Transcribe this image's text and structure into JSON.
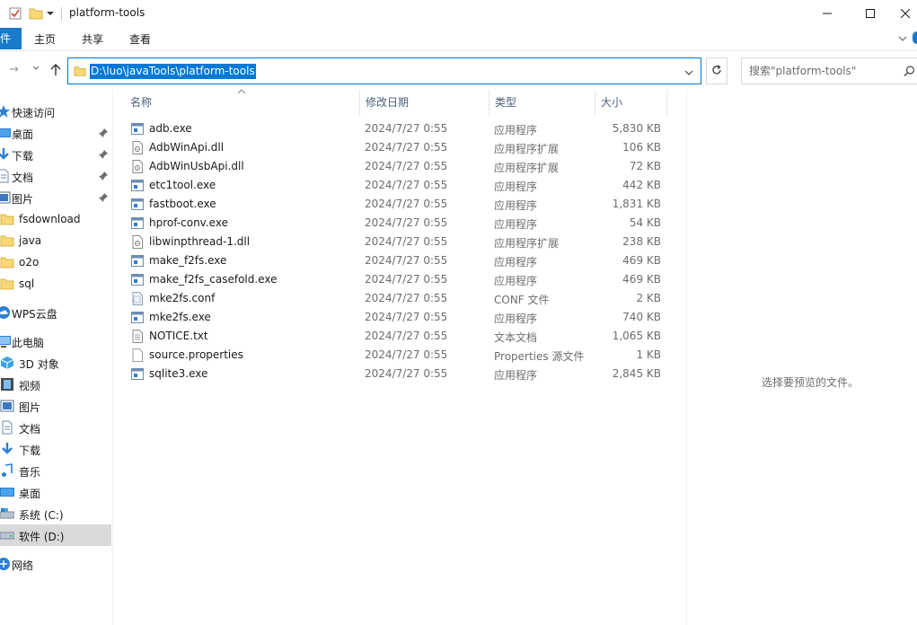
{
  "window": {
    "title": "platform-tools",
    "controls": {
      "minimize": "─",
      "maximize": "☐",
      "close": "✕"
    }
  },
  "ribbon": {
    "file_tab": "文件",
    "tabs": [
      "主页",
      "共享",
      "查看"
    ]
  },
  "address": {
    "path": "D:\\luo\\javaTools\\platform-tools",
    "search_placeholder": "搜索\"platform-tools\""
  },
  "sidebar": {
    "items": [
      {
        "label": "快速访问",
        "icon": "star-icon",
        "pinned": false
      },
      {
        "label": "桌面",
        "icon": "desktop-icon",
        "pinned": true
      },
      {
        "label": "下载",
        "icon": "download-icon",
        "pinned": true
      },
      {
        "label": "文档",
        "icon": "document-icon",
        "pinned": true
      },
      {
        "label": "图片",
        "icon": "picture-icon",
        "pinned": true
      },
      {
        "label": "fsdownload",
        "icon": "folder-icon",
        "pinned": false
      },
      {
        "label": "java",
        "icon": "folder-icon",
        "pinned": false
      },
      {
        "label": "o2o",
        "icon": "folder-icon",
        "pinned": false
      },
      {
        "label": "sql",
        "icon": "folder-icon",
        "pinned": false
      },
      {
        "label": "WPS云盘",
        "icon": "cloud-icon",
        "pinned": false
      },
      {
        "label": "此电脑",
        "icon": "computer-icon",
        "pinned": false
      },
      {
        "label": "3D 对象",
        "icon": "3d-objects-icon",
        "pinned": false
      },
      {
        "label": "视频",
        "icon": "video-icon",
        "pinned": false
      },
      {
        "label": "图片",
        "icon": "picture-icon",
        "pinned": false
      },
      {
        "label": "文档",
        "icon": "document-icon",
        "pinned": false
      },
      {
        "label": "下载",
        "icon": "download-icon",
        "pinned": false
      },
      {
        "label": "音乐",
        "icon": "music-icon",
        "pinned": false
      },
      {
        "label": "桌面",
        "icon": "desktop-icon",
        "pinned": false
      },
      {
        "label": "系统 (C:)",
        "icon": "drive-c-icon",
        "pinned": false
      },
      {
        "label": "软件 (D:)",
        "icon": "drive-d-icon",
        "pinned": false,
        "selected": true
      },
      {
        "label": "网络",
        "icon": "network-icon",
        "pinned": false
      }
    ]
  },
  "columns": {
    "name": "名称",
    "date": "修改日期",
    "type": "类型",
    "size": "大小"
  },
  "files": [
    {
      "name": "adb.exe",
      "date": "2024/7/27 0:55",
      "type": "应用程序",
      "size": "5,830 KB",
      "icon": "exe-icon"
    },
    {
      "name": "AdbWinApi.dll",
      "date": "2024/7/27 0:55",
      "type": "应用程序扩展",
      "size": "106 KB",
      "icon": "dll-icon"
    },
    {
      "name": "AdbWinUsbApi.dll",
      "date": "2024/7/27 0:55",
      "type": "应用程序扩展",
      "size": "72 KB",
      "icon": "dll-icon"
    },
    {
      "name": "etc1tool.exe",
      "date": "2024/7/27 0:55",
      "type": "应用程序",
      "size": "442 KB",
      "icon": "exe-icon"
    },
    {
      "name": "fastboot.exe",
      "date": "2024/7/27 0:55",
      "type": "应用程序",
      "size": "1,831 KB",
      "icon": "exe-icon"
    },
    {
      "name": "hprof-conv.exe",
      "date": "2024/7/27 0:55",
      "type": "应用程序",
      "size": "54 KB",
      "icon": "exe-icon"
    },
    {
      "name": "libwinpthread-1.dll",
      "date": "2024/7/27 0:55",
      "type": "应用程序扩展",
      "size": "238 KB",
      "icon": "dll-icon"
    },
    {
      "name": "make_f2fs.exe",
      "date": "2024/7/27 0:55",
      "type": "应用程序",
      "size": "469 KB",
      "icon": "exe-icon"
    },
    {
      "name": "make_f2fs_casefold.exe",
      "date": "2024/7/27 0:55",
      "type": "应用程序",
      "size": "469 KB",
      "icon": "exe-icon"
    },
    {
      "name": "mke2fs.conf",
      "date": "2024/7/27 0:55",
      "type": "CONF 文件",
      "size": "2 KB",
      "icon": "conf-file-icon"
    },
    {
      "name": "mke2fs.exe",
      "date": "2024/7/27 0:55",
      "type": "应用程序",
      "size": "740 KB",
      "icon": "exe-icon"
    },
    {
      "name": "NOTICE.txt",
      "date": "2024/7/27 0:55",
      "type": "文本文档",
      "size": "1,065 KB",
      "icon": "text-file-icon"
    },
    {
      "name": "source.properties",
      "date": "2024/7/27 0:55",
      "type": "Properties 源文件",
      "size": "1 KB",
      "icon": "properties-file-icon"
    },
    {
      "name": "sqlite3.exe",
      "date": "2024/7/27 0:55",
      "type": "应用程序",
      "size": "2,845 KB",
      "icon": "exe-icon"
    }
  ],
  "preview": {
    "message": "选择要预览的文件。"
  },
  "colors": {
    "accent": "#0078d7",
    "ribbon_file_tab": "#1979ca",
    "folder": "#f8d775",
    "header_text": "#4c607a"
  }
}
